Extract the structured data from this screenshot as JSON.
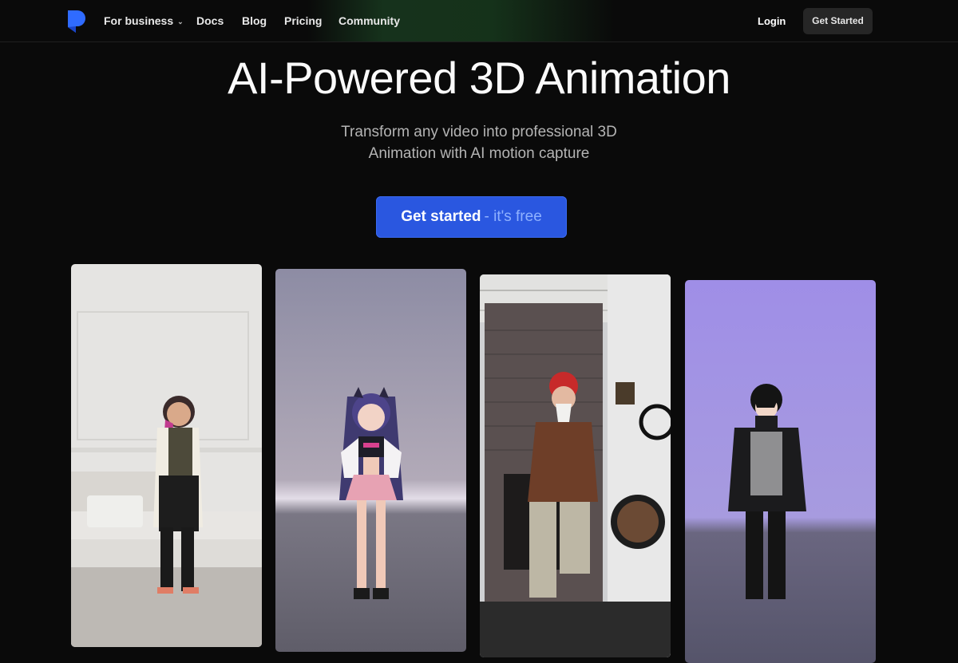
{
  "nav": {
    "logo_icon": "brand-logo-icon",
    "items": [
      {
        "label": "For business",
        "has_dropdown": true
      },
      {
        "label": "Docs"
      },
      {
        "label": "Blog"
      },
      {
        "label": "Pricing"
      },
      {
        "label": "Community"
      }
    ],
    "login_label": "Login",
    "get_started_label": "Get Started"
  },
  "hero": {
    "title": "AI-Powered 3D Animation",
    "subtitle_line1": "Transform any video into professional 3D",
    "subtitle_line2": "Animation with AI motion capture",
    "cta_main": "Get started",
    "cta_suffix": "- it's free"
  },
  "showcase": [
    {
      "kind": "video-frame",
      "subject": "woman with pink hair dancing"
    },
    {
      "kind": "3d-avatar",
      "subject": "anime girl avatar"
    },
    {
      "kind": "video-frame",
      "subject": "older man in red beanie dancing"
    },
    {
      "kind": "3d-avatar",
      "subject": "anime boy avatar"
    }
  ],
  "colors": {
    "background": "#0a0a0a",
    "cta_blue": "#2a57e0",
    "brand_blue": "#2f6bff",
    "nav_button": "#262626"
  }
}
